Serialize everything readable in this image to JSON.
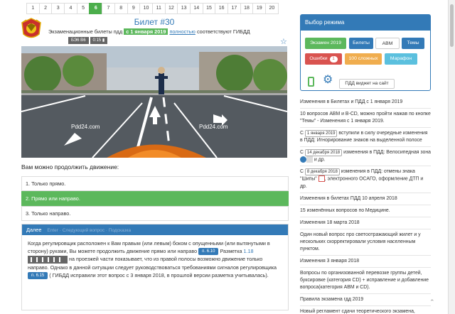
{
  "pagination": [
    "1",
    "2",
    "3",
    "4",
    "5",
    "6",
    "7",
    "8",
    "9",
    "10",
    "11",
    "12",
    "13",
    "14",
    "15",
    "16",
    "17",
    "18",
    "19",
    "20"
  ],
  "active_page": "6",
  "ticket": {
    "title": "Билет #30",
    "subtitle_pre": "Экзаменационные билеты пдд",
    "subtitle_date": "с 1 января 2019",
    "subtitle_link": "полностью",
    "subtitle_post": "соответствуют ГИБДД",
    "chip_category": "БЭ6 В6",
    "chip_timer": "0:15",
    "watermark": "Pdd24.com",
    "question": "Вам можно продолжить движение:"
  },
  "answers": [
    {
      "label": "1. Только прямо."
    },
    {
      "label": "2. Прямо или направо."
    },
    {
      "label": "3. Только направо."
    }
  ],
  "explanation": {
    "header": "Далее",
    "header_next": "Enter · Следующий вопрос · Подсказка",
    "text1": "Когда регулировщик расположен к Вам правым (или левым) боком с опущенными (или вытянутыми в сторону) руками, Вы можете продолжить движение прямо или направо",
    "tag1": "п. 6.10",
    "text2": "Разметка",
    "link1": "1.18",
    "text3": "на проезжей части показывает, что из правой полосы возможно движение только направо. Однако в данной ситуации следует руководствоваться требованиями сигналов регулировщика",
    "tag2": "п. 6.15",
    "text4": "( ГИБДД исправили этот вопрос с 3 января 2018, в прошлой версии разметка учитывалась)."
  },
  "mode_panel": {
    "title": "Выбор режима",
    "btn_exam": "Экзамен 2019",
    "btn_tickets": "Билеты",
    "btn_abm": "АВМ",
    "btn_topics": "Темы",
    "btn_errors": "Ошибки",
    "errors_count": "1",
    "btn_hard": "100 сложных",
    "btn_marathon": "Марафон",
    "widget_label": "ПДД виджет на сайт"
  },
  "news": {
    "n1": "Изменения в Билетах и ПДД с 1 января 2019",
    "n2": "10 вопросов АВМ и В-СD, можно пройти нажав по кнопке \"Темы\" - Изменения с 1 января 2019.",
    "n3_pre": "С",
    "n3_box": "1 января 2019",
    "n3_post": "вступили в силу очередные изменения в ПДД: Игнорирование знаков на выделенной полосе",
    "n4_pre": "С",
    "n4_box": "14 декабря 2018",
    "n4_post": "изменения в ПДД: Велосипедная зона",
    "n4_end": "и др.",
    "n5_pre": "С",
    "n5_box": "8 декабря 2018",
    "n5_post": "изменения в ПДД: отмены знака \"Шипы\"",
    "n5_end": ", электронного ОСАГО, оформление ДТП и др.",
    "n6": "Изменения в билетах ПДД 10 апреля 2018",
    "n7": "15 изменённых вопросов по Медицине.",
    "n8": "Изменения 18 марта 2018",
    "n9": "Один новый вопрос про светоотражающий жилет и у нескольких скорректировали условия населенным пунктом.",
    "n10": "Изменения 3 января 2018",
    "n11": "Вопросы по организованной перевозке группы детей, буксировке (категория CD) + исправление и добавление вопроса(категория АВМ и CD).",
    "n12": "Правила экзамена гдд 2019",
    "n13": "Новый регламент сдачи теоретического экзамена,"
  },
  "colors": {
    "accent": "#337ab7",
    "success": "#5cb85c",
    "danger": "#d9534f",
    "warning": "#f0ad4e",
    "info": "#5bc0de"
  },
  "icons": {
    "emblem": "gibdd-emblem-icon",
    "star": "star-icon",
    "phone": "phone-icon",
    "gear": "gear-icon",
    "timer": "timer-icon"
  }
}
